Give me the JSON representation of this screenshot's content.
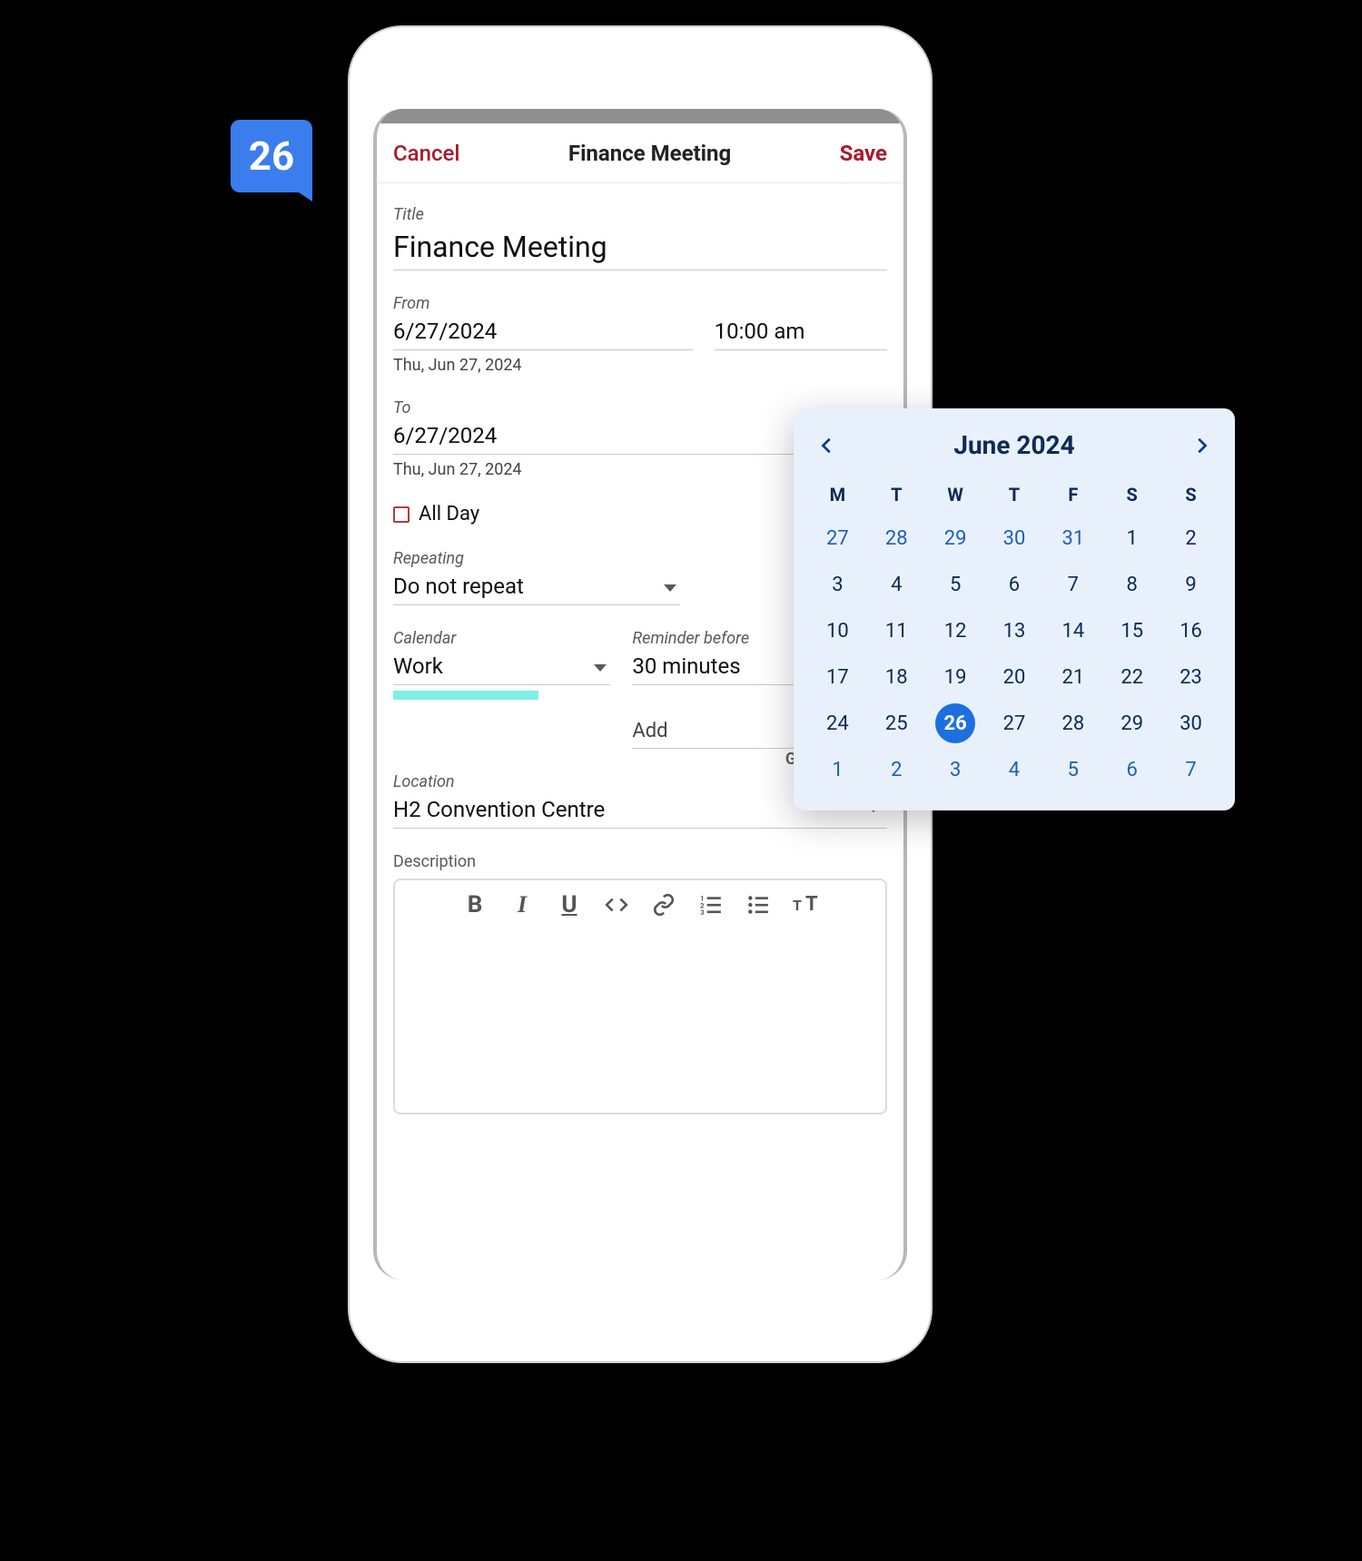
{
  "badge": {
    "day": "26"
  },
  "header": {
    "cancel": "Cancel",
    "title": "Finance Meeting",
    "save": "Save"
  },
  "event": {
    "title_label": "Title",
    "title": "Finance Meeting",
    "guests_label": "GUESTS",
    "from_label": "From",
    "from_date": "6/27/2024",
    "from_time": "10:00 am",
    "from_day": "Thu, Jun 27, 2024",
    "to_label": "To",
    "to_date": "6/27/2024",
    "to_day": "Thu, Jun 27, 2024",
    "all_day_label": "All Day",
    "repeating_label": "Repeating",
    "repeating_value": "Do not repeat",
    "calendar_label": "Calendar",
    "calendar_value": "Work",
    "calendar_color": "#7ef0e4",
    "reminder_label": "Reminder before",
    "reminder_value": "30 minutes",
    "add_placeholder": "Add",
    "location_label": "Location",
    "location_value": "H2 Convention Centre",
    "description_label": "Description"
  },
  "editor": {
    "tools": [
      "bold",
      "italic",
      "underline",
      "code",
      "link",
      "ordered-list",
      "unordered-list",
      "text-size"
    ]
  },
  "datepicker": {
    "month_label": "June 2024",
    "dow": [
      "M",
      "T",
      "W",
      "T",
      "F",
      "S",
      "S"
    ],
    "weeks": [
      [
        {
          "d": 27,
          "other": true
        },
        {
          "d": 28,
          "other": true
        },
        {
          "d": 29,
          "other": true
        },
        {
          "d": 30,
          "other": true
        },
        {
          "d": 31,
          "other": true
        },
        {
          "d": 1
        },
        {
          "d": 2
        }
      ],
      [
        {
          "d": 3
        },
        {
          "d": 4
        },
        {
          "d": 5
        },
        {
          "d": 6
        },
        {
          "d": 7
        },
        {
          "d": 8
        },
        {
          "d": 9
        }
      ],
      [
        {
          "d": 10
        },
        {
          "d": 11
        },
        {
          "d": 12
        },
        {
          "d": 13
        },
        {
          "d": 14
        },
        {
          "d": 15
        },
        {
          "d": 16
        }
      ],
      [
        {
          "d": 17
        },
        {
          "d": 18
        },
        {
          "d": 19
        },
        {
          "d": 20
        },
        {
          "d": 21
        },
        {
          "d": 22
        },
        {
          "d": 23
        }
      ],
      [
        {
          "d": 24
        },
        {
          "d": 25
        },
        {
          "d": 26,
          "selected": true
        },
        {
          "d": 27
        },
        {
          "d": 28
        },
        {
          "d": 29
        },
        {
          "d": 30
        }
      ],
      [
        {
          "d": 1,
          "other": true
        },
        {
          "d": 2,
          "other": true
        },
        {
          "d": 3,
          "other": true
        },
        {
          "d": 4,
          "other": true
        },
        {
          "d": 5,
          "other": true
        },
        {
          "d": 6,
          "other": true
        },
        {
          "d": 7,
          "other": true
        }
      ]
    ]
  },
  "colors": {
    "accent": "#a71b2e",
    "badge": "#3b7ded",
    "picker_bg": "#e8f1fb",
    "picker_selected": "#1d6fe0"
  }
}
